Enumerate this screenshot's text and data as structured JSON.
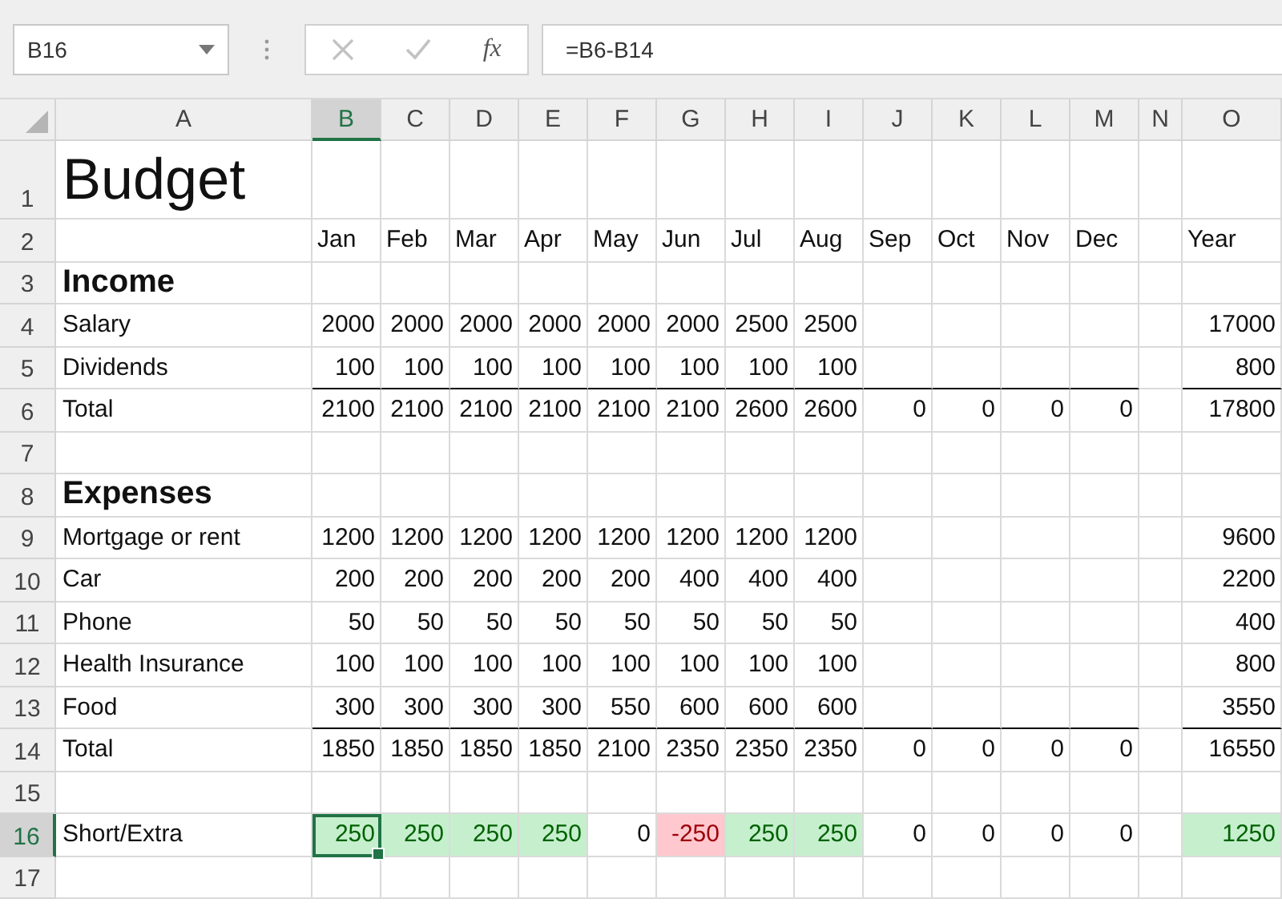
{
  "name_box": "B16",
  "function_button": "fx",
  "formula": "=B6-B14",
  "columns": [
    {
      "label": "A",
      "selected": false
    },
    {
      "label": "B",
      "selected": true
    },
    {
      "label": "C",
      "selected": false
    },
    {
      "label": "D",
      "selected": false
    },
    {
      "label": "E",
      "selected": false
    },
    {
      "label": "F",
      "selected": false
    },
    {
      "label": "G",
      "selected": false
    },
    {
      "label": "H",
      "selected": false
    },
    {
      "label": "I",
      "selected": false
    },
    {
      "label": "J",
      "selected": false
    },
    {
      "label": "K",
      "selected": false
    },
    {
      "label": "L",
      "selected": false
    },
    {
      "label": "M",
      "selected": false
    },
    {
      "label": "N",
      "selected": false
    },
    {
      "label": "O",
      "selected": false
    }
  ],
  "rows": [
    {
      "number": "1",
      "selected": false,
      "kind": "title",
      "label": "Budget"
    },
    {
      "number": "2",
      "selected": false,
      "kind": "header",
      "values": [
        "Jan",
        "Feb",
        "Mar",
        "Apr",
        "May",
        "Jun",
        "Jul",
        "Aug",
        "Sep",
        "Oct",
        "Nov",
        "Dec"
      ],
      "year": "Year"
    },
    {
      "number": "3",
      "selected": false,
      "kind": "section",
      "label": "Income"
    },
    {
      "number": "4",
      "selected": false,
      "kind": "data",
      "label": "Salary",
      "values": [
        "2000",
        "2000",
        "2000",
        "2000",
        "2000",
        "2000",
        "2500",
        "2500"
      ],
      "year": "17000"
    },
    {
      "number": "5",
      "selected": false,
      "kind": "data",
      "label": "Dividends",
      "values": [
        "100",
        "100",
        "100",
        "100",
        "100",
        "100",
        "100",
        "100"
      ],
      "year": "800",
      "underline": true
    },
    {
      "number": "6",
      "selected": false,
      "kind": "data",
      "label": "Total",
      "values": [
        "2100",
        "2100",
        "2100",
        "2100",
        "2100",
        "2100",
        "2600",
        "2600",
        "0",
        "0",
        "0",
        "0"
      ],
      "year": "17800"
    },
    {
      "number": "7",
      "selected": false,
      "kind": "empty"
    },
    {
      "number": "8",
      "selected": false,
      "kind": "section",
      "label": "Expenses"
    },
    {
      "number": "9",
      "selected": false,
      "kind": "data",
      "label": "Mortgage or rent",
      "values": [
        "1200",
        "1200",
        "1200",
        "1200",
        "1200",
        "1200",
        "1200",
        "1200"
      ],
      "year": "9600"
    },
    {
      "number": "10",
      "selected": false,
      "kind": "data",
      "label": "Car",
      "values": [
        "200",
        "200",
        "200",
        "200",
        "200",
        "400",
        "400",
        "400"
      ],
      "year": "2200"
    },
    {
      "number": "11",
      "selected": false,
      "kind": "data",
      "label": "Phone",
      "values": [
        "50",
        "50",
        "50",
        "50",
        "50",
        "50",
        "50",
        "50"
      ],
      "year": "400"
    },
    {
      "number": "12",
      "selected": false,
      "kind": "data",
      "label": "Health Insurance",
      "values": [
        "100",
        "100",
        "100",
        "100",
        "100",
        "100",
        "100",
        "100"
      ],
      "year": "800"
    },
    {
      "number": "13",
      "selected": false,
      "kind": "data",
      "label": "Food",
      "values": [
        "300",
        "300",
        "300",
        "300",
        "550",
        "600",
        "600",
        "600"
      ],
      "year": "3550",
      "underline": true
    },
    {
      "number": "14",
      "selected": false,
      "kind": "data",
      "label": "Total",
      "values": [
        "1850",
        "1850",
        "1850",
        "1850",
        "2100",
        "2350",
        "2350",
        "2350",
        "0",
        "0",
        "0",
        "0"
      ],
      "year": "16550"
    },
    {
      "number": "15",
      "selected": false,
      "kind": "empty"
    },
    {
      "number": "16",
      "selected": true,
      "kind": "data",
      "label": "Short/Extra",
      "values": [
        {
          "text": "250",
          "color": "#c6efce"
        },
        {
          "text": "250",
          "color": "#c6efce"
        },
        {
          "text": "250",
          "color": "#c6efce"
        },
        {
          "text": "250",
          "color": "#c6efce"
        },
        {
          "text": "0"
        },
        {
          "text": "-250",
          "color": "#ffc7ce"
        },
        {
          "text": "250",
          "color": "#c6efce"
        },
        {
          "text": "250",
          "color": "#c6efce"
        },
        {
          "text": "0"
        },
        {
          "text": "0"
        },
        {
          "text": "0"
        },
        {
          "text": "0"
        }
      ],
      "year": {
        "text": "1250",
        "color": "#c6efce"
      }
    },
    {
      "number": "17",
      "selected": false,
      "kind": "empty"
    }
  ]
}
